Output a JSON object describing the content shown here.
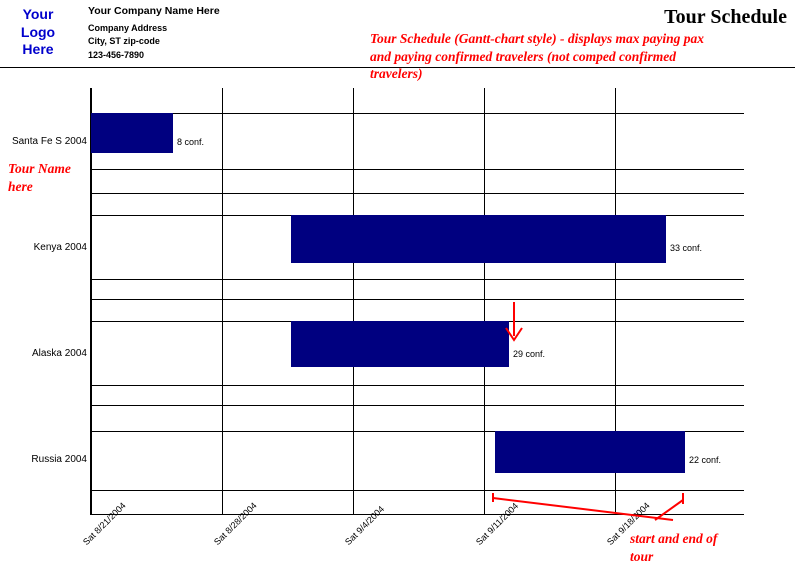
{
  "header": {
    "logo_l1": "Your",
    "logo_l2": "Logo",
    "logo_l3": "Here",
    "company_name": "Your Company Name Here",
    "company_address": "Company Address",
    "company_city": "City, ST  zip-code",
    "company_phone": "123-456-7890",
    "title": "Tour Schedule"
  },
  "annotations": {
    "desc_l1": "Tour Schedule (Gantt-chart style) - displays max paying pax",
    "desc_l2": "and paying confirmed travelers (not comped confirmed",
    "desc_l3": "travelers)",
    "tour_name_l1": "Tour Name",
    "tour_name_l2": "here",
    "start_end_l1": "start and end of",
    "start_end_l2": "tour"
  },
  "chart_data": {
    "type": "bar",
    "title": "Tour Schedule",
    "orientation": "horizontal-gantt",
    "x_ticks": [
      "Sat 8/21/2004",
      "Sat 8/28/2004",
      "Sat 9/4/2004",
      "Sat 9/11/2004",
      "Sat 9/18/2004"
    ],
    "x_range_days": [
      0,
      35
    ],
    "categories": [
      "Santa Fe S 2004",
      "Kenya 2004",
      "Alaska 2004",
      "Russia 2004"
    ],
    "series": [
      {
        "name": "Santa Fe S 2004",
        "start_day": 0,
        "end_day": 4.4,
        "confirmed": 8,
        "label": "8 conf."
      },
      {
        "name": "Kenya 2004",
        "start_day": 10.7,
        "end_day": 30.8,
        "confirmed": 33,
        "label": "33 conf."
      },
      {
        "name": "Alaska 2004",
        "start_day": 10.7,
        "end_day": 22.4,
        "confirmed": 29,
        "label": "29 conf."
      },
      {
        "name": "Russia 2004",
        "start_day": 21.6,
        "end_day": 31.8,
        "confirmed": 22,
        "label": "22 conf."
      }
    ]
  }
}
